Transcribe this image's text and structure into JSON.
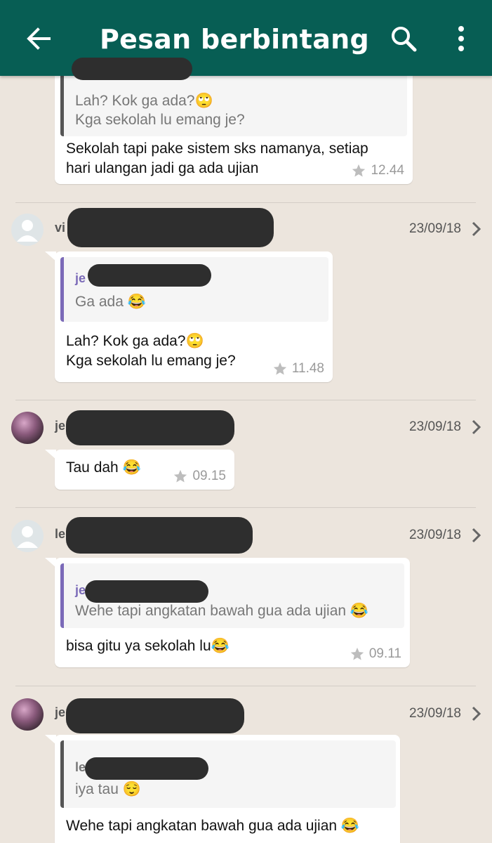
{
  "app_bar": {
    "title": "Pesan berbintang",
    "back_icon": "arrow-back-icon",
    "search_icon": "search-icon",
    "more_icon": "more-vert-icon",
    "color": "#075e54"
  },
  "messages": [
    {
      "quote_name": "",
      "quote_text": "Lah? Kok ga ada?🙄\nKga sekolah lu emang je?",
      "text": "Sekolah tapi pake sistem sks namanya, setiap\nhari ulangan jadi ga ada ujian",
      "time": "12.44",
      "starred": true
    },
    {
      "sender": "vi",
      "date": "23/09/18",
      "quote_name": "je",
      "quote_text": "Ga ada 😂",
      "text": "Lah? Kok ga ada?🙄\nKga sekolah lu emang je?",
      "time": "11.48",
      "starred": true
    },
    {
      "sender": "je",
      "date": "23/09/18",
      "text": "Tau dah 😂",
      "time": "09.15",
      "starred": true
    },
    {
      "sender": "le",
      "date": "23/09/18",
      "quote_name": "je",
      "quote_text": "Wehe tapi angkatan bawah gua ada ujian 😂",
      "text": "bisa gitu ya sekolah lu😂",
      "time": "09.11",
      "starred": true
    },
    {
      "sender": "je",
      "date": "23/09/18",
      "quote_name": "le",
      "quote_text": "iya tau 😌",
      "text": "Wehe tapi angkatan bawah gua ada ujian 😂",
      "time": "",
      "starred": false
    }
  ]
}
